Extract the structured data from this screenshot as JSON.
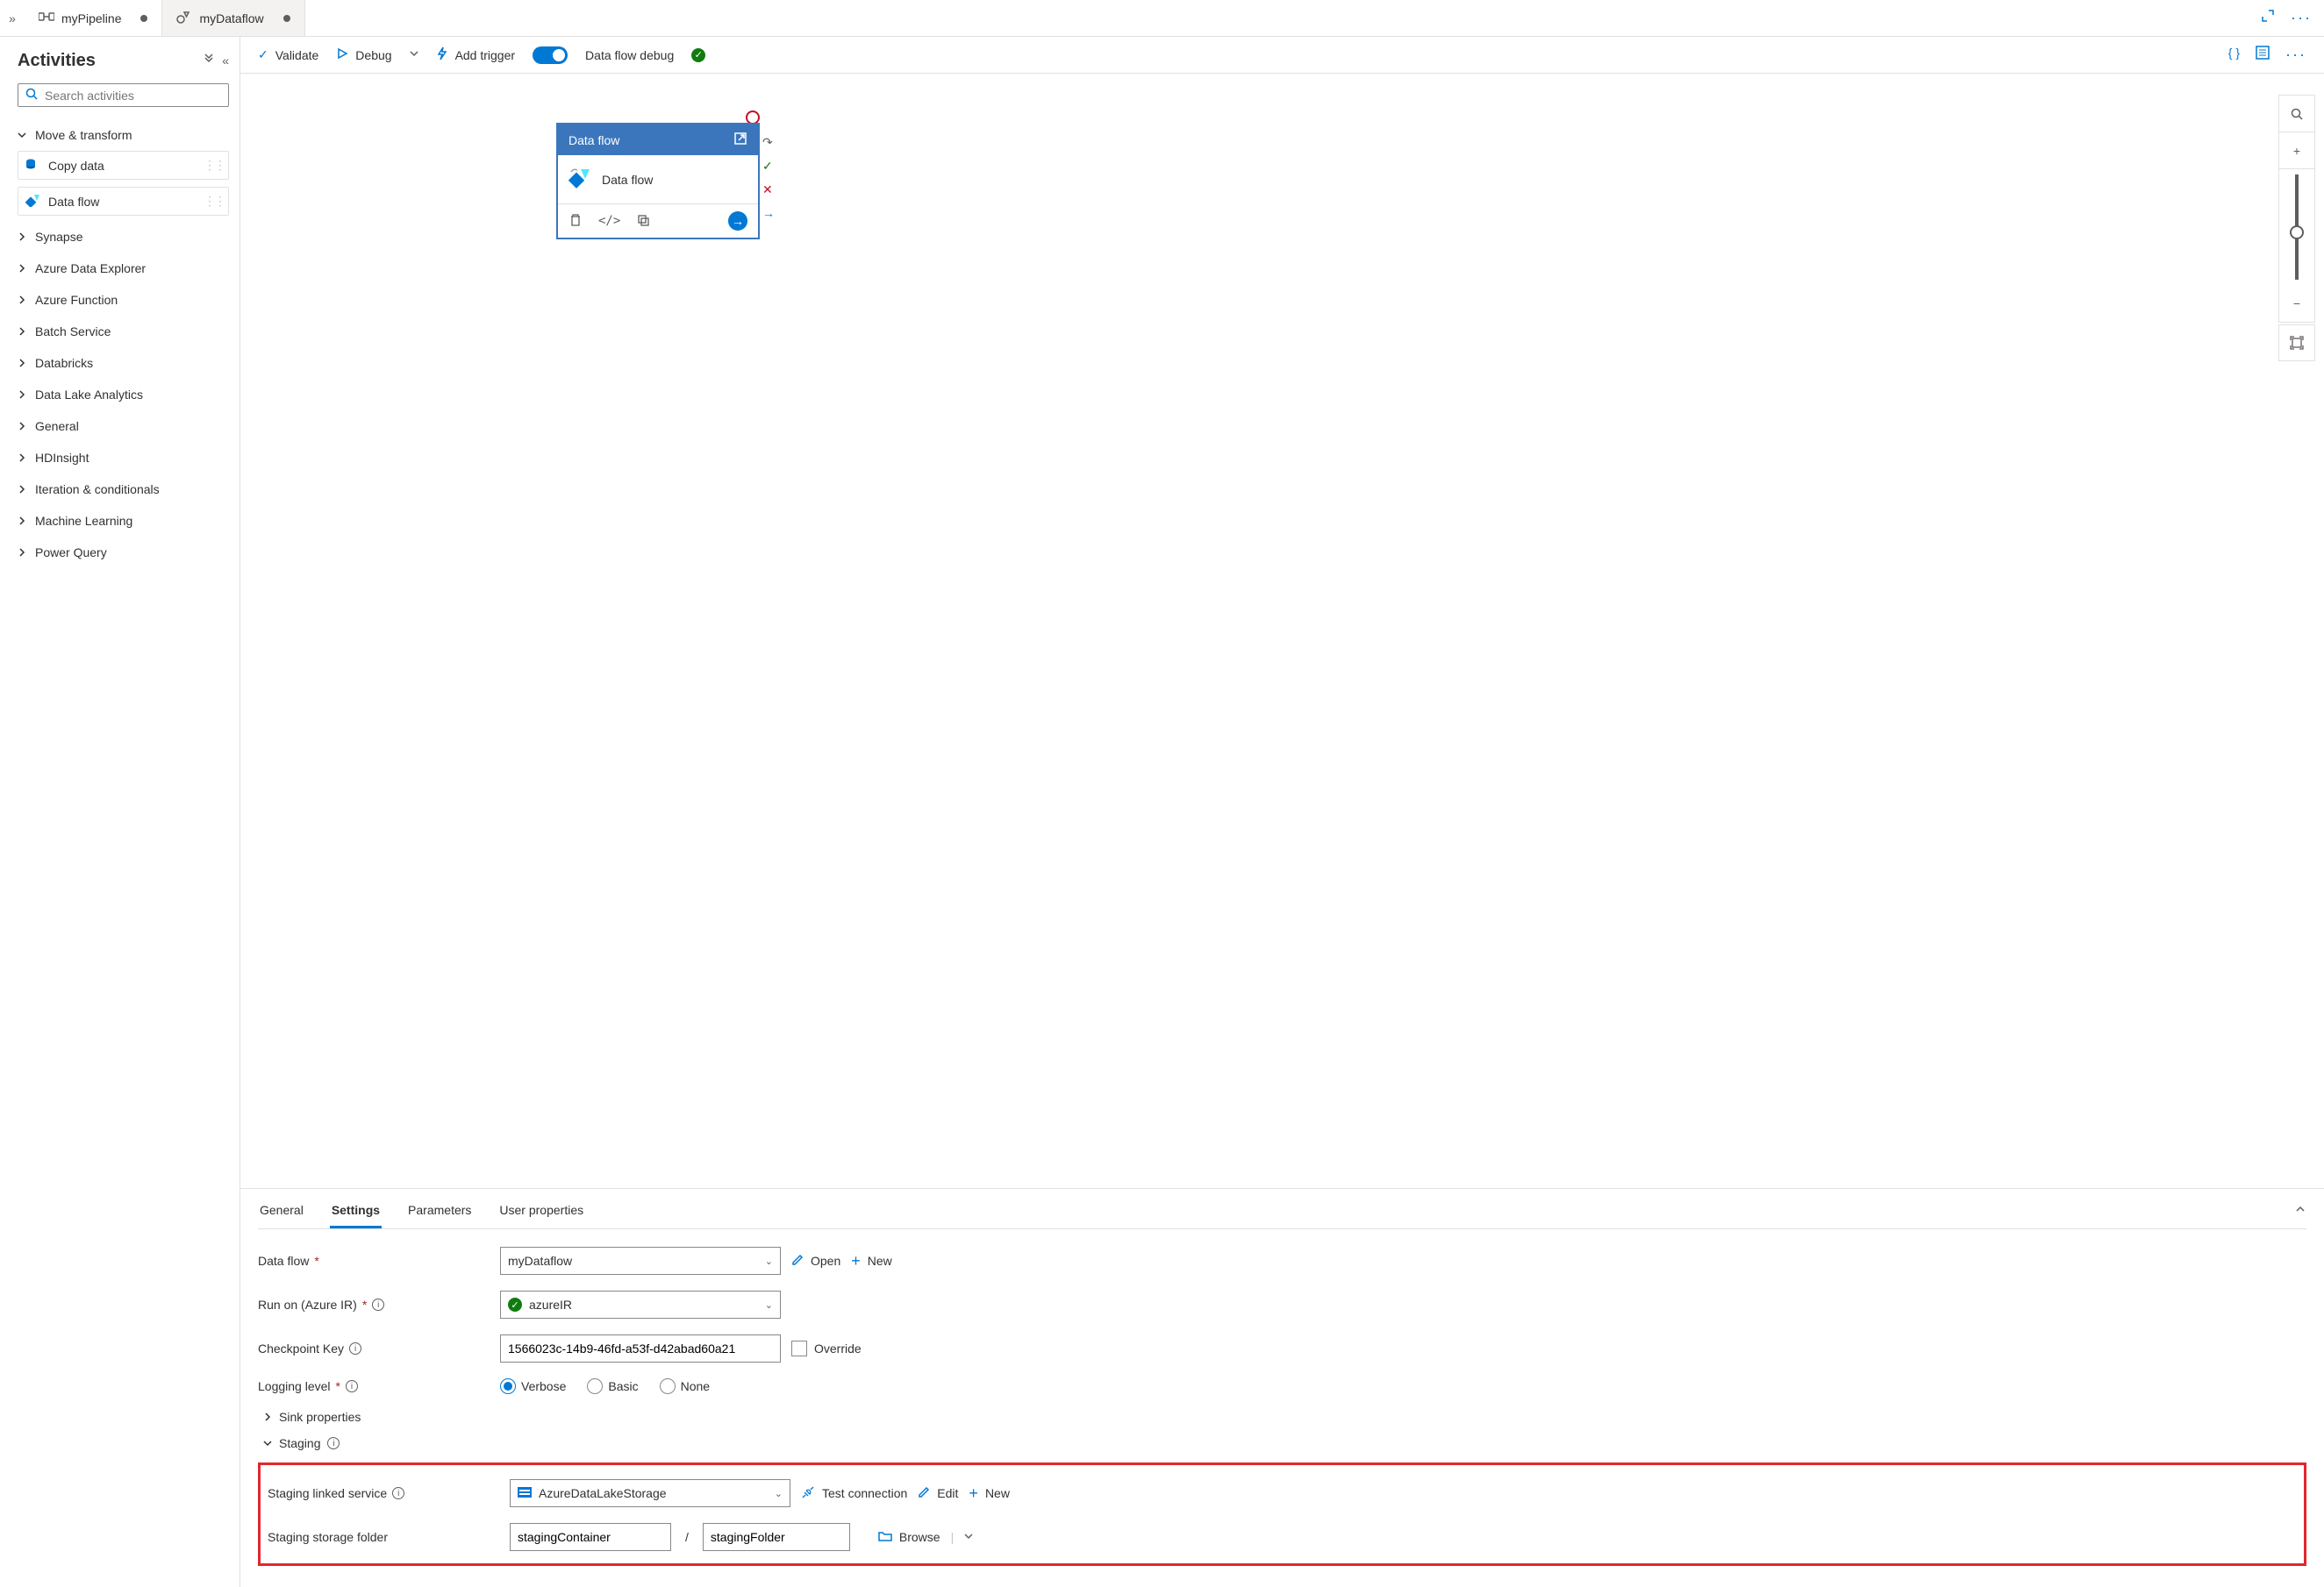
{
  "tabs": [
    {
      "label": "myPipeline",
      "dirty": true,
      "active": true
    },
    {
      "label": "myDataflow",
      "dirty": true,
      "active": false
    }
  ],
  "sidebar": {
    "title": "Activities",
    "searchPlaceholder": "Search activities",
    "moveTransform": {
      "label": "Move & transform",
      "items": [
        "Copy data",
        "Data flow"
      ]
    },
    "groups": [
      "Synapse",
      "Azure Data Explorer",
      "Azure Function",
      "Batch Service",
      "Databricks",
      "Data Lake Analytics",
      "General",
      "HDInsight",
      "Iteration & conditionals",
      "Machine Learning",
      "Power Query"
    ]
  },
  "toolbar": {
    "validate": "Validate",
    "debug": "Debug",
    "addTrigger": "Add trigger",
    "dataflowDebug": "Data flow debug"
  },
  "node": {
    "header": "Data flow",
    "title": "Data flow"
  },
  "panel": {
    "tabs": [
      "General",
      "Settings",
      "Parameters",
      "User properties"
    ],
    "activeTab": 1,
    "dataFlowLabel": "Data flow",
    "dataFlowValue": "myDataflow",
    "open": "Open",
    "new": "New",
    "runOnLabel": "Run on (Azure IR)",
    "runOnValue": "azureIR",
    "checkpointLabel": "Checkpoint Key",
    "checkpointValue": "1566023c-14b9-46fd-a53f-d42abad60a21",
    "override": "Override",
    "loggingLabel": "Logging level",
    "loggingOptions": [
      "Verbose",
      "Basic",
      "None"
    ],
    "sinkProps": "Sink properties",
    "staging": "Staging",
    "stagingLinkedLabel": "Staging linked service",
    "stagingLinkedValue": "AzureDataLakeStorage",
    "testConn": "Test connection",
    "edit": "Edit",
    "stagingFolderLabel": "Staging storage folder",
    "stagingContainer": "stagingContainer",
    "stagingFolder": "stagingFolder",
    "browse": "Browse"
  }
}
